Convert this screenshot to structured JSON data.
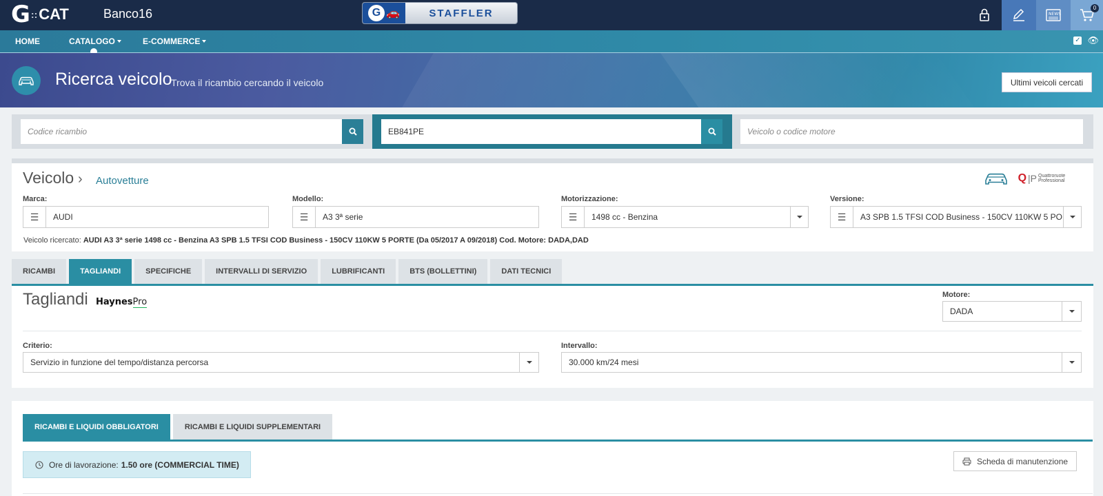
{
  "topbar": {
    "logo_g": "G",
    "logo_cat": "CAT",
    "station": "Banco16",
    "brand": "STAFFLER",
    "cart_count": "0"
  },
  "nav": {
    "items": [
      {
        "label": "HOME"
      },
      {
        "label": "CATALOGO"
      },
      {
        "label": "E-COMMERCE"
      }
    ]
  },
  "hero": {
    "title": "Ricerca veicolo",
    "subtitle": "Trova il ricambio cercando il veicolo",
    "button": "Ultimi veicoli cercati"
  },
  "search": {
    "codice_placeholder": "Codice ricambio",
    "targa_value": "EB841PE",
    "veicolo_placeholder": "Veicolo o codice motore"
  },
  "vehicle": {
    "title": "Veicolo",
    "category": "Autovetture",
    "qp_brand": "Quattroruote Professional",
    "fields": [
      {
        "label": "Marca:",
        "value": "AUDI"
      },
      {
        "label": "Modello:",
        "value": "A3 3ª serie"
      },
      {
        "label": "Motorizzazione:",
        "value": "1498 cc - Benzina"
      },
      {
        "label": "Versione:",
        "value": "A3 SPB 1.5 TFSI COD Business - 150CV 110KW 5 PORTE"
      }
    ],
    "searched_label": "Veicolo ricercato:",
    "searched_value": "AUDI A3 3ª serie 1498 cc - Benzina A3 SPB 1.5 TFSI COD Business - 150CV 110KW 5 PORTE (Da 05/2017 A 09/2018) Cod. Motore: DADA,DAD"
  },
  "tabs": [
    {
      "label": "RICAMBI"
    },
    {
      "label": "TAGLIANDI",
      "active": true
    },
    {
      "label": "SPECIFICHE"
    },
    {
      "label": "INTERVALLI DI SERVIZIO"
    },
    {
      "label": "LUBRIFICANTI"
    },
    {
      "label": "BTS (BOLLETTINI)"
    },
    {
      "label": "DATI TECNICI"
    }
  ],
  "tagliandi": {
    "title": "Tagliandi",
    "provider_bold": "Haynes",
    "provider_rest": "Pro",
    "motore_label": "Motore:",
    "motore_value": "DADA",
    "criterio_label": "Criterio:",
    "criterio_value": "Servizio in funzione del tempo/distanza percorsa",
    "intervallo_label": "Intervallo:",
    "intervallo_value": "30.000 km/24 mesi"
  },
  "bottom": {
    "tabs": [
      {
        "label": "RICAMBI E LIQUIDI OBBLIGATORI",
        "active": true
      },
      {
        "label": "RICAMBI E LIQUIDI SUPPLEMENTARI"
      }
    ],
    "ore_label": "Ore di lavorazione:",
    "ore_value": "1.50 ore (COMMERCIAL TIME)",
    "scheda_button": "Scheda di manutenzione"
  },
  "colors": {
    "topbar": "#1a2b48",
    "accent": "#2a8ea3",
    "search_button": "#2a7f97"
  }
}
